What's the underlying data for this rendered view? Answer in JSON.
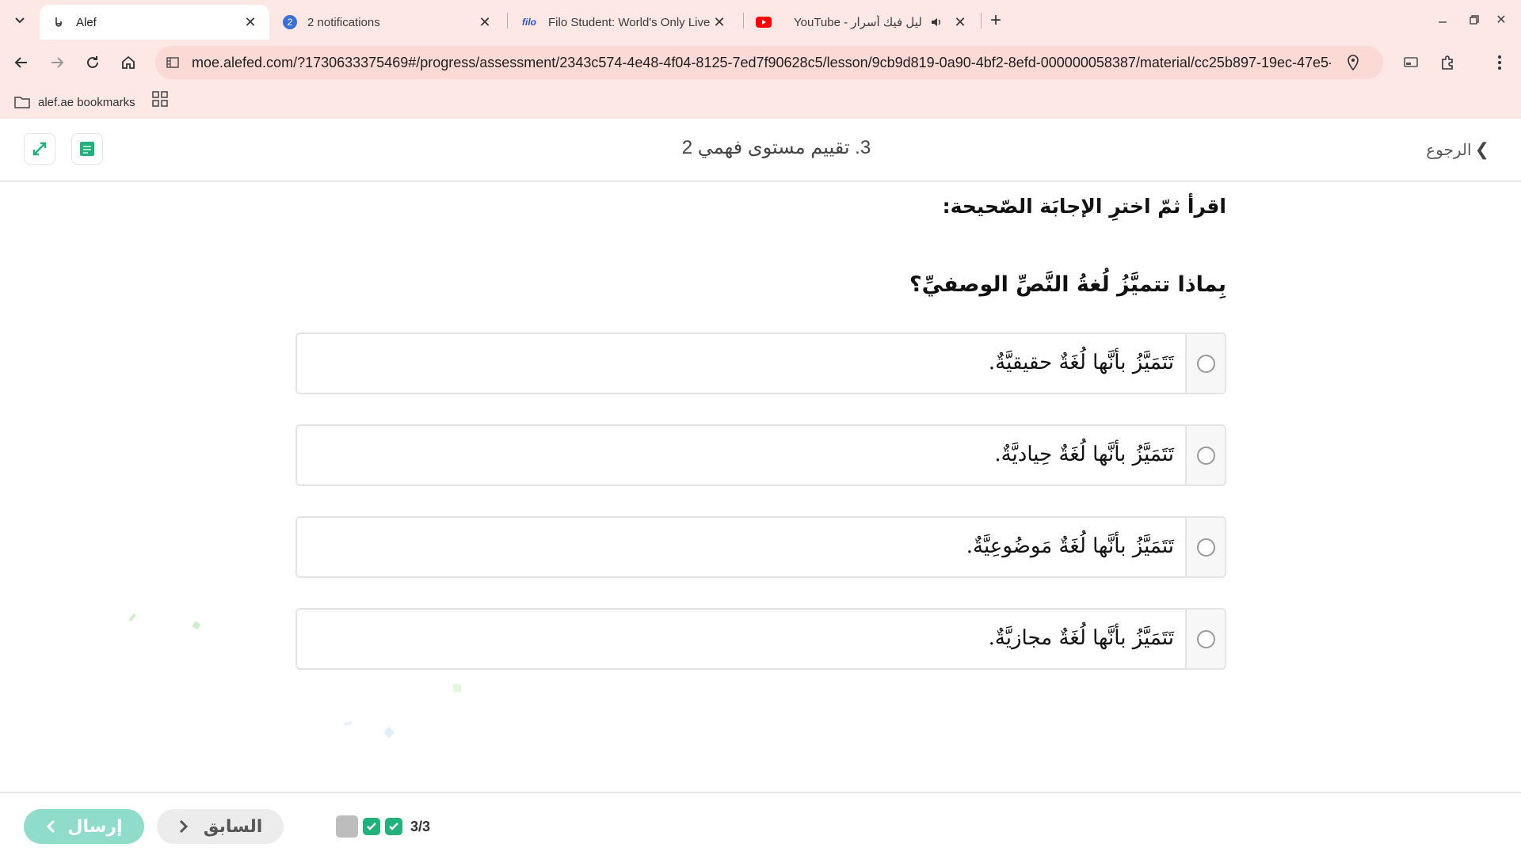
{
  "browser": {
    "tabs": [
      {
        "title": "Alef",
        "favicon": "alef-icon",
        "active": true
      },
      {
        "title": "2 notifications",
        "favicon": "notification-badge",
        "badge": "2",
        "active": false
      },
      {
        "title": "Filo Student: World's Only Live I",
        "favicon": "filo-logo",
        "favicon_text": "filo",
        "active": false
      },
      {
        "title": "YouTube - يا ليل فيك أسرار",
        "favicon": "youtube-logo",
        "active": false,
        "audio": true
      }
    ],
    "url": "moe.alefed.com/?1730633375469#/progress/assessment/2343c574-4e48-4f04-8125-7ed7f90628c5/lesson/9cb9d819-0a90-4bf2-8efd-000000058387/material/cc25b897-19ec-47e5-...",
    "bookmark_label": "alef.ae bookmarks"
  },
  "header": {
    "title": "3. تقييم مستوى فهمي 2",
    "back_label": "الرجوع"
  },
  "content": {
    "instruction": "اقرأ ثمّ اخترِ الإجابَة الصّحيحة:",
    "question": "بِماذا تتميَّزُ لُغةُ النَّصِّ الوصفيِّ؟",
    "options": [
      {
        "label": "تَتَمَيَّزُ بأنَّها لُغَةٌ حقيقيَّةٌ."
      },
      {
        "label": "تَتَمَيَّزُ بأنَّها لُغَةٌ حِياديَّةٌ."
      },
      {
        "label": "تَتَمَيَّزُ بأنَّها لُغَةٌ مَوضُوعِيَّةٌ."
      },
      {
        "label": "تَتَمَيَّزُ بأنَّها لُغَةٌ مجازيَّةٌ."
      }
    ]
  },
  "footer": {
    "submit_label": "إرسال",
    "prev_label": "السابق",
    "progress_count": "3/3"
  },
  "colors": {
    "chrome_bg": "#fde8e6",
    "submit_bg": "#8fdcca",
    "check_green": "#22b07d"
  }
}
